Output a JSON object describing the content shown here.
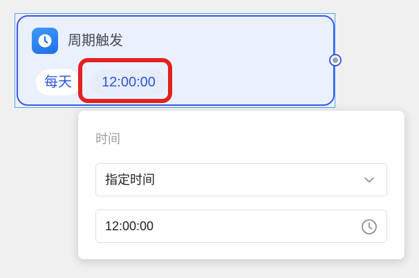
{
  "trigger_node": {
    "title": "周期触发",
    "icon": "clock-icon",
    "frequency": "每天",
    "time": "12:00:00"
  },
  "popover": {
    "section_label": "时间",
    "mode_select": {
      "value": "指定时间",
      "icon": "chevron-down-icon"
    },
    "time_input": {
      "value": "12:00:00",
      "icon": "clock-icon"
    }
  },
  "colors": {
    "node_border": "#3a59e8",
    "node_background": "#eaf0fd",
    "pill_text": "#2c57d8",
    "highlight": "#e3211f",
    "icon_blue": "#1f6fe8"
  }
}
